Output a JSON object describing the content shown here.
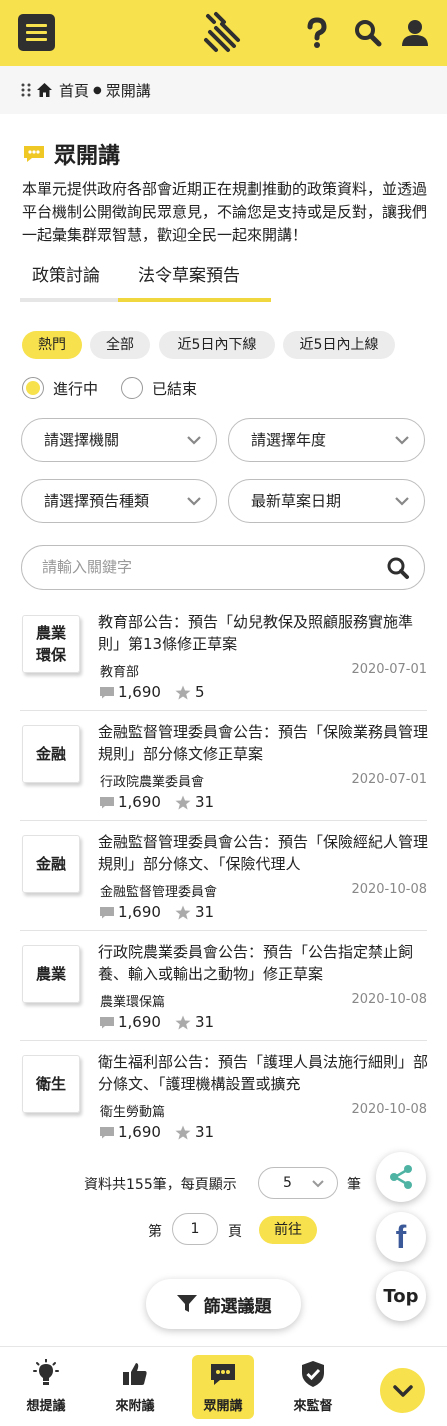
{
  "header": {
    "icons": [
      "menu-icon",
      "hands-logo-icon",
      "help-icon",
      "search-icon",
      "user-icon"
    ]
  },
  "breadcrumb": {
    "home": "首頁",
    "current": "眾開講"
  },
  "page": {
    "title": "眾開講",
    "intro": "本單元提供政府各部會近期正在規劃推動的政策資料，並透過平台機制公開徵詢民眾意見，不論您是支持或是反對，讓我們一起彙集群眾智慧，歡迎全民一起來開講！"
  },
  "tabs": [
    {
      "label": "政策討論",
      "active": false
    },
    {
      "label": "法令草案預告",
      "active": true
    }
  ],
  "chips": [
    {
      "label": "熱門",
      "active": true
    },
    {
      "label": "全部",
      "active": false
    },
    {
      "label": "近5日內下線",
      "active": false
    },
    {
      "label": "近5日內上線",
      "active": false
    }
  ],
  "status": {
    "ongoing": "進行中",
    "ended": "已結束",
    "selected": "ongoing"
  },
  "filters": {
    "agency": "請選擇機關",
    "year": "請選擇年度",
    "type": "請選擇預告種類",
    "sort": "最新草案日期"
  },
  "search": {
    "placeholder": "請輸入關鍵字"
  },
  "items": [
    {
      "tag": "農業環保",
      "title": "教育部公告：預告「幼兒教保及照顧服務實施準則」第13條修正草案",
      "org": "教育部",
      "date": "2020-07-01",
      "comments": "1,690",
      "stars": "5"
    },
    {
      "tag": "金融",
      "title": "金融監督管理委員會公告：預告「保險業務員管理規則」部分條文修正草案",
      "org": "行政院農業委員會",
      "date": "2020-07-01",
      "comments": "1,690",
      "stars": "31"
    },
    {
      "tag": "金融",
      "title": "金融監督管理委員會公告：預告「保險經紀人管理規則」部分條文、「保險代理人",
      "org": "金融監督管理委員會",
      "date": "2020-10-08",
      "comments": "1,690",
      "stars": "31"
    },
    {
      "tag": "農業",
      "title": "行政院農業委員會公告：預告「公告指定禁止飼養、輸入或輸出之動物」修正草案",
      "org": "農業環保篇",
      "date": "2020-10-08",
      "comments": "1,690",
      "stars": "31"
    },
    {
      "tag": "衛生",
      "title": "衛生福利部公告：預告「護理人員法施行細則」部分條文、「護理機構設置或擴充",
      "org": "衛生勞動篇",
      "date": "2020-10-08",
      "comments": "1,690",
      "stars": "31"
    }
  ],
  "pagination": {
    "summary": "資料共155筆，每頁顯示",
    "per_page": "5",
    "unit": "筆",
    "page_prefix": "第",
    "page": "1",
    "page_suffix": "頁",
    "go": "前往"
  },
  "filter_button": "篩選議題",
  "floating": {
    "share": "share-icon",
    "facebook": "f",
    "top": "Top"
  },
  "bottom_nav": [
    {
      "label": "想提議",
      "icon": "lightbulb-icon",
      "active": false
    },
    {
      "label": "來附議",
      "icon": "thumbs-up-icon",
      "active": false
    },
    {
      "label": "眾開講",
      "icon": "chat-icon",
      "active": true
    },
    {
      "label": "來監督",
      "icon": "shield-check-icon",
      "active": false
    }
  ],
  "colors": {
    "accent": "#f7e14c",
    "dark": "#2f2f2f",
    "share": "#4fb3a4",
    "facebook": "#3b5998"
  }
}
